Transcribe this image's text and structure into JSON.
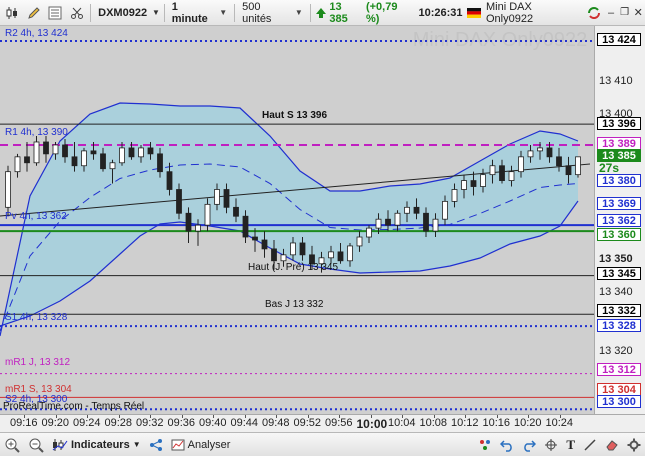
{
  "toolbar": {
    "symbol": "DXM0922",
    "timeframe": "1 minute",
    "units": "500 unités",
    "last_price": "13 385",
    "change": "(+0,79 %)",
    "time": "10:26:31",
    "instrument": "Mini DAX Only0922"
  },
  "watermark": "Mini DAX Only0922",
  "levels": {
    "r2": "R2 4h, 13 424",
    "r1": "R1 4h, 13 390",
    "haut_s": "Haut S 13 396",
    "pivot": "Pv 4h, 13 362",
    "haut_j_pre": "Haut (J. Pré) 13 345",
    "bas_j": "Bas J 13 332",
    "s1": "S1 4h, 13 328",
    "mr1_j": "mR1 J, 13 312",
    "mr1_s": "mR1 S, 13 304",
    "s2": "S2 4h, 13 300"
  },
  "credit": "ProRealTime.com - Temps Réel",
  "price_axis": {
    "plain": [
      "13 410",
      "13 400",
      "13 350",
      "13 340",
      "13 320"
    ],
    "boxed": [
      {
        "label": "13 424",
        "bg": "#ffffff",
        "fg": "#000000"
      },
      {
        "label": "13 396",
        "bg": "#ffffff",
        "fg": "#000000"
      },
      {
        "label": "13 389",
        "bg": "#ffffff",
        "fg": "#c020c0"
      },
      {
        "label": "13 385",
        "bg": "#1c8a1c",
        "fg": "#ffffff"
      },
      {
        "label": "13 380",
        "bg": "#ffffff",
        "fg": "#2030d0"
      },
      {
        "label": "13 369",
        "bg": "#ffffff",
        "fg": "#2030d0"
      },
      {
        "label": "13 362",
        "bg": "#ffffff",
        "fg": "#2030d0"
      },
      {
        "label": "13 360",
        "bg": "#ffffff",
        "fg": "#1c8a1c"
      },
      {
        "label": "13 345",
        "bg": "#ffffff",
        "fg": "#000000"
      },
      {
        "label": "13 332",
        "bg": "#ffffff",
        "fg": "#000000"
      },
      {
        "label": "13 328",
        "bg": "#ffffff",
        "fg": "#2030d0"
      },
      {
        "label": "13 312",
        "bg": "#ffffff",
        "fg": "#c020c0"
      },
      {
        "label": "13 304",
        "bg": "#ffffff",
        "fg": "#d03030"
      },
      {
        "label": "13 300",
        "bg": "#ffffff",
        "fg": "#2030d0"
      }
    ],
    "countdown": "27s"
  },
  "time_axis": [
    "09:16",
    "09:20",
    "09:24",
    "09:28",
    "09:32",
    "09:36",
    "09:40",
    "09:44",
    "09:48",
    "09:52",
    "09:56",
    "10:00",
    "10:04",
    "10:08",
    "10:12",
    "10:16",
    "10:20",
    "10:24"
  ],
  "bottombar": {
    "indicators": "Indicateurs",
    "analyser": "Analyser"
  },
  "colors": {
    "up": "#ffffff",
    "down": "#222222",
    "band_fill": "#a8d0dc",
    "band_line": "#2030d0",
    "accent_green": "#1c8a1c"
  }
}
